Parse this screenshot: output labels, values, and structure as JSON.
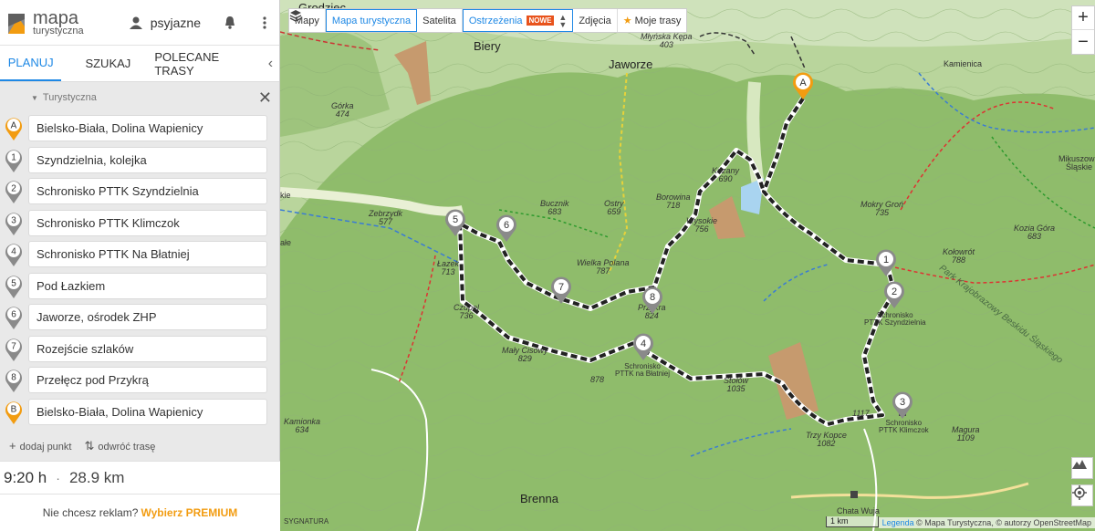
{
  "app": {
    "logo_line1": "mapa",
    "logo_line2": "turystyczna",
    "username": "psyjazne"
  },
  "tabs": [
    {
      "label": "PLANUJ"
    },
    {
      "label": "SZUKAJ"
    },
    {
      "label": "POLECANE TRASY"
    }
  ],
  "plan": {
    "mode_label": "Turystyczna",
    "waypoints": [
      {
        "marker": "A",
        "name": "Bielsko-Biała, Dolina Wapienicy",
        "color": "#f29c11"
      },
      {
        "marker": "1",
        "name": "Szyndzielnia, kolejka",
        "color": "#8a8a8a"
      },
      {
        "marker": "2",
        "name": "Schronisko PTTK Szyndzielnia",
        "color": "#8a8a8a"
      },
      {
        "marker": "3",
        "name": "Schronisko PTTK Klimczok",
        "color": "#8a8a8a"
      },
      {
        "marker": "4",
        "name": "Schronisko PTTK Na Błatniej",
        "color": "#8a8a8a"
      },
      {
        "marker": "5",
        "name": "Pod Łazkiem",
        "color": "#8a8a8a"
      },
      {
        "marker": "6",
        "name": "Jaworze, ośrodek ZHP",
        "color": "#8a8a8a"
      },
      {
        "marker": "7",
        "name": "Rozejście szlaków",
        "color": "#8a8a8a"
      },
      {
        "marker": "8",
        "name": "Przełęcz pod Przykrą",
        "color": "#8a8a8a"
      },
      {
        "marker": "B",
        "name": "Bielsko-Biała, Dolina Wapienicy",
        "color": "#f29c11"
      }
    ],
    "add_point": "dodaj punkt",
    "reverse_route": "odwróć trasę"
  },
  "summary": {
    "time": "9:20 h",
    "separator": "·",
    "distance": "28.9 km"
  },
  "promo": {
    "text": "Nie chcesz reklam?",
    "premium": "Wybierz PREMIUM"
  },
  "map": {
    "layers": [
      {
        "label": "Mapy"
      },
      {
        "label": "Mapa turystyczna"
      },
      {
        "label": "Satelita"
      },
      {
        "label": "Ostrzeżenia"
      },
      {
        "label": "Zdjęcia"
      },
      {
        "label": "Moje trasy"
      }
    ],
    "new_badge": "NOWE",
    "zoom_in": "+",
    "zoom_out": "−",
    "scale": "1 km",
    "attribution_link": "Legenda",
    "attribution_text": "© Mapa Turystyczna, © autorzy OpenStreetMap",
    "labels": {
      "grodziec": "Grodziec",
      "biery": "Biery",
      "jaworze": "Jaworze",
      "brenna": "Brenna",
      "kamienica": "Kamienica",
      "mikuszowice": "Mikuszowice Śląskie",
      "mlynska": "Młyńska Kępa\n403",
      "gorka": "Górka\n474",
      "zebrzydk": "Zebrzydk\n577",
      "lazek": "Łazek\n713",
      "czupel": "Czupel\n736",
      "bucznik": "Bucznik\n683",
      "ostry": "Ostry\n659",
      "borowina": "Borowina\n718",
      "kozany": "Kozany\n690",
      "wysokie": "Wysokie\n756",
      "wielka_polana": "Wielka Polana\n787",
      "przykra": "Przykra\n824",
      "maly_cisowy": "Mały Cisowy\n829",
      "pt878": "878",
      "blatnia": "Schronisko\nPTTK na Błatniej",
      "stolow": "Stołów\n1035",
      "mokry_gron": "Mokry Groń\n735",
      "kolowrot": "Kołowrót\n788",
      "kozia_gora": "Kozia Góra\n683",
      "szyndzielnia_shelter": "Schronisko\nPTTK Szyndzielnia",
      "klimczok": "Schronisko\nPTTK Klimczok",
      "magura": "Magura\n1109",
      "trzy_kopce": "Trzy Kopce\n1082",
      "pt1117": "1117",
      "kamionka": "Kamionka\n634",
      "chata_wuja": "Chata Wuja",
      "park": "Park Krajobrazowy Beskidu Śląskiego",
      "signatura": "SYGNATURA",
      "ale": "ałe",
      "kie": "kie"
    }
  }
}
